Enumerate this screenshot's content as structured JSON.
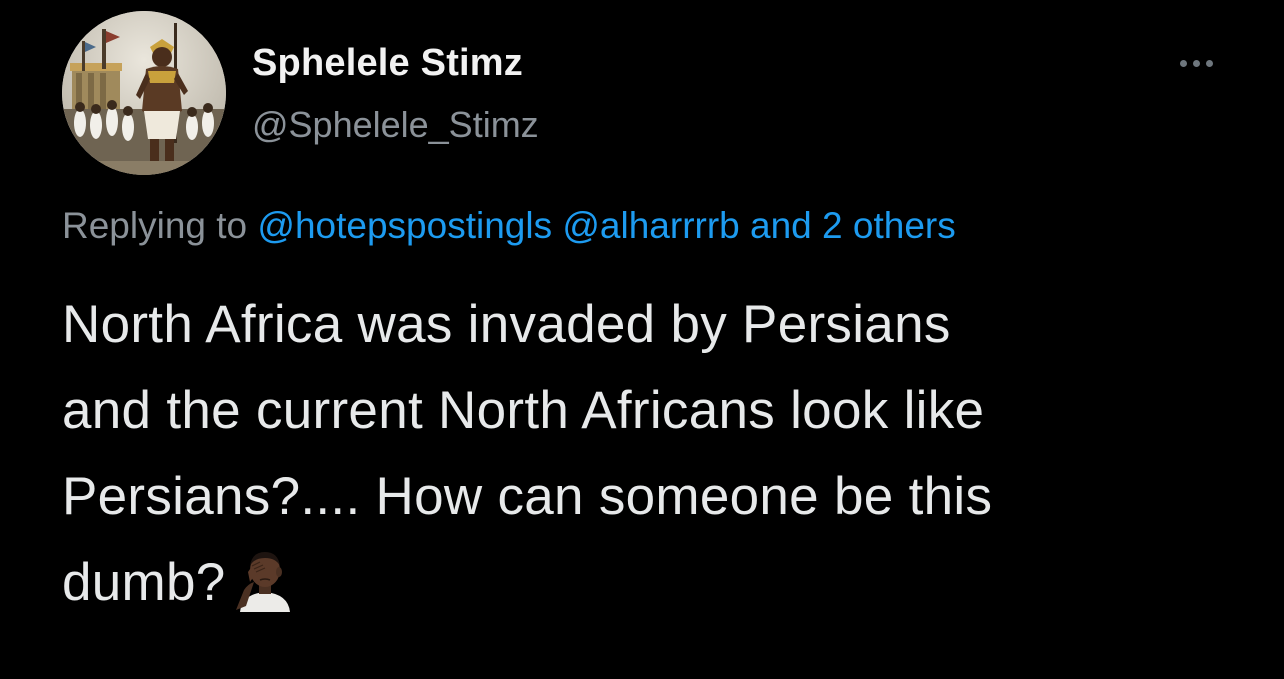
{
  "tweet": {
    "author": {
      "display_name": "Sphelele Stimz",
      "handle": "@Sphelele_Stimz",
      "avatar_icon": "pharaoh-painting-avatar"
    },
    "menu_icon": "more-options-icon",
    "reply_context": {
      "prefix": "Replying to",
      "mention_1": "@hotepspostingls",
      "mention_2": "@alharrrrb",
      "others": "and 2 others"
    },
    "text_lines": [
      "North Africa was invaded by Persians",
      "and the current North Africans look like",
      "Persians?.... How can someone be this",
      "dumb?"
    ],
    "emoji": "face-palm-emoji"
  },
  "colors": {
    "background": "#000000",
    "text": "#e7e9ea",
    "secondary": "#8b9299",
    "link": "#1d9bf0"
  }
}
